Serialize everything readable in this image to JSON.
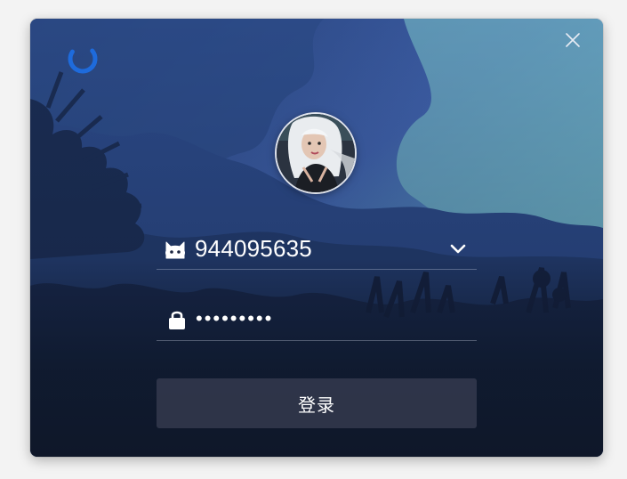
{
  "app": {
    "logo_icon": "loading-ring-icon",
    "close_icon": "close-icon",
    "accent_color": "#1e6bdc"
  },
  "account": {
    "icon": "cat-face-icon",
    "value": "944095635",
    "dropdown_icon": "chevron-down-icon"
  },
  "password": {
    "icon": "lock-icon",
    "value": "•••••••••"
  },
  "login_button": {
    "label": "登录"
  },
  "avatar": {
    "icon": "user-avatar"
  }
}
